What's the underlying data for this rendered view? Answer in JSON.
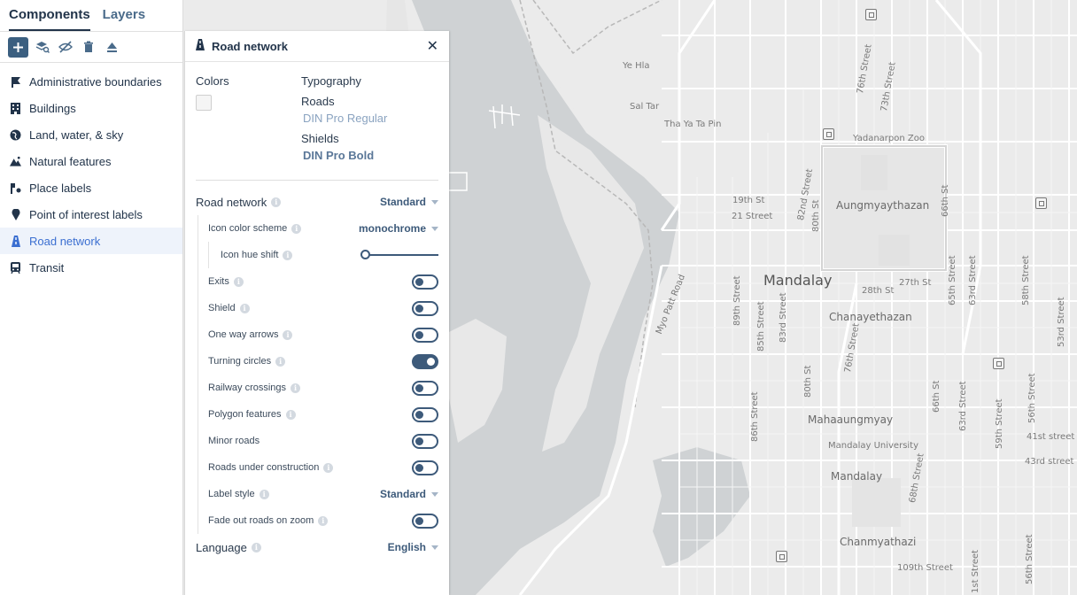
{
  "sidebar": {
    "tabs": [
      {
        "label": "Components"
      },
      {
        "label": "Layers"
      }
    ],
    "toolbar": [
      "add-icon",
      "layers-view-icon",
      "hide-icon",
      "trash-icon",
      "eject-icon"
    ],
    "items": [
      {
        "label": "Administrative boundaries",
        "icon": "flag-icon"
      },
      {
        "label": "Buildings",
        "icon": "building-icon"
      },
      {
        "label": "Land, water, & sky",
        "icon": "globe-icon"
      },
      {
        "label": "Natural features",
        "icon": "mountain-icon"
      },
      {
        "label": "Place labels",
        "icon": "place-label-icon"
      },
      {
        "label": "Point of interest labels",
        "icon": "pin-icon"
      },
      {
        "label": "Road network",
        "icon": "road-icon"
      },
      {
        "label": "Transit",
        "icon": "train-icon"
      }
    ],
    "active_item": "Road network"
  },
  "panel": {
    "title": "Road network",
    "colors_label": "Colors",
    "typography_label": "Typography",
    "roads_label": "Roads",
    "roads_font": "DIN Pro Regular",
    "shields_label": "Shields",
    "shields_font": "DIN Pro Bold",
    "road_network": {
      "label": "Road network",
      "value": "Standard"
    },
    "icon_color_scheme": {
      "label": "Icon color scheme",
      "value": "monochrome"
    },
    "icon_hue_shift": {
      "label": "Icon hue shift",
      "value": 0
    },
    "toggles": [
      {
        "label": "Exits",
        "on": false
      },
      {
        "label": "Shield",
        "on": false
      },
      {
        "label": "One way arrows",
        "on": false
      },
      {
        "label": "Turning circles",
        "on": true
      },
      {
        "label": "Railway crossings",
        "on": false
      },
      {
        "label": "Polygon features",
        "on": false
      },
      {
        "label": "Minor roads",
        "on": false
      },
      {
        "label": "Roads under construction",
        "on": false
      }
    ],
    "label_style": {
      "label": "Label style",
      "value": "Standard"
    },
    "fade_out": {
      "label": "Fade out roads on zoom",
      "on": false
    },
    "language": {
      "label": "Language",
      "value": "English"
    }
  },
  "map": {
    "labels": {
      "ye_hla": "Ye Hla",
      "sal_tar": "Sal Tar",
      "tha_ya_ta_pin": "Tha Ya Ta Pin",
      "yadanarpon_zoo": "Yadanarpon Zoo",
      "aungmyaythazan": "Aungmyaythazan",
      "mandalay_city": "Mandalay",
      "chanayethazan": "Chanayethazan",
      "mahaaungmyay": "Mahaaungmyay",
      "mandalay_university": "Mandalay University",
      "mandalay_district": "Mandalay",
      "chanmyathazi": "Chanmyathazi",
      "myo_patt_road": "Myo Patt Road",
      "st_19th": "19th St",
      "st_21": "21 Street",
      "st_28th": "28th St",
      "st_27th": "27th St",
      "st_82nd": "82nd Street",
      "st_80th_top": "80th St",
      "st_66th_top": "66th St",
      "st_76th_top": "76th Street",
      "st_73rd_top": "73th Street",
      "st_89th": "89th Street",
      "st_85th": "85th Street",
      "st_83rd": "83rd Street",
      "st_76th_mid": "76th Street",
      "st_80th_mid": "80th St",
      "st_86th": "86th Street",
      "st_66th_mid": "66th St",
      "st_63rd": "63rd Street",
      "st_65th": "65th Street",
      "st_63rd_top": "63rd Street",
      "st_58th": "58th Street",
      "st_53rd": "53rd Street",
      "st_56th": "56th Street",
      "st_59th": "59th Street",
      "st_41st": "41st street",
      "st_43rd": "43rd street",
      "st_68th": "68th Street",
      "st_109th": "109th Street",
      "st_56th_bot": "56th Street",
      "st_1st": "1st Street"
    }
  }
}
